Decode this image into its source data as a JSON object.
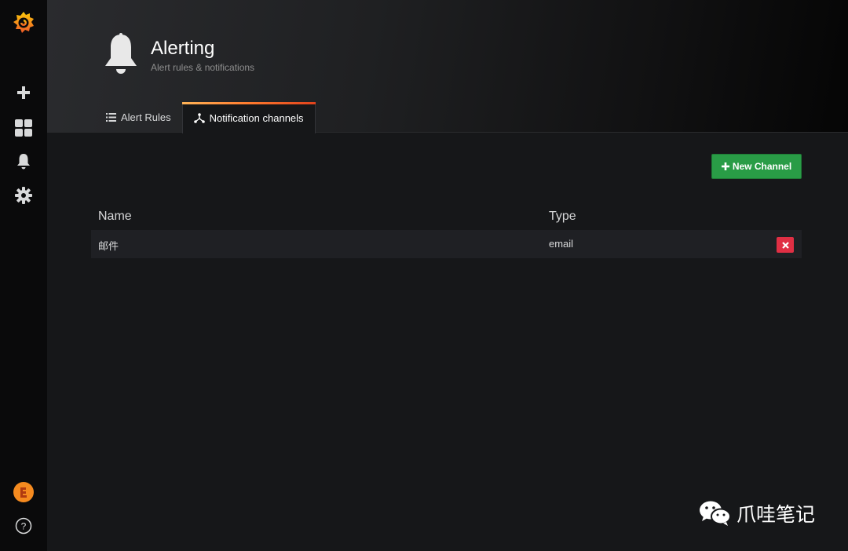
{
  "sidebar": {
    "icons": [
      "grafana-logo",
      "plus-icon",
      "dashboards-icon",
      "bell-icon",
      "gear-icon",
      "avatar",
      "help-icon"
    ]
  },
  "header": {
    "title": "Alerting",
    "subtitle": "Alert rules & notifications"
  },
  "tabs": [
    {
      "label": "Alert Rules",
      "active": false
    },
    {
      "label": "Notification channels",
      "active": true
    }
  ],
  "actions": {
    "new_channel_label": "New Channel"
  },
  "table": {
    "columns": [
      "Name",
      "Type"
    ],
    "rows": [
      {
        "name": "邮件",
        "type": "email"
      }
    ]
  },
  "watermark": {
    "text": "爪哇笔记"
  },
  "colors": {
    "accent_green": "#299c46",
    "delete_red": "#e02f44",
    "tab_gradient_start": "#ffb357",
    "tab_gradient_end": "#e0421c"
  }
}
